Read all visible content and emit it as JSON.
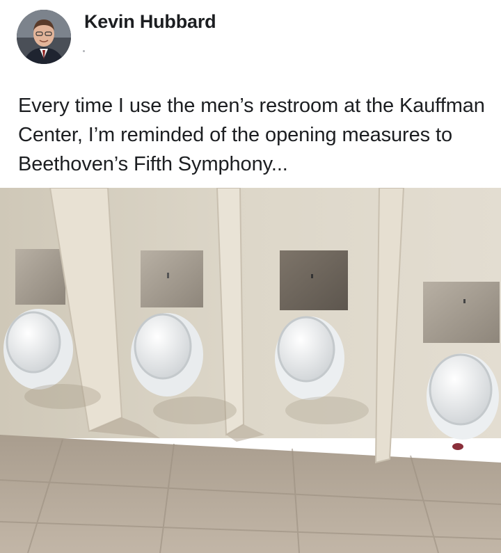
{
  "post": {
    "author_name": "Kevin Hubbard",
    "avatar_icon": "person-avatar-icon",
    "text": "Every time I use the men’s restroom at the Kauffman Center, I’m reminded of the opening measures to Beethoven’s Fifth Symphony...",
    "photo": {
      "subject": "urinals-photo",
      "colors": {
        "wall": "#d9d3c4",
        "floor": "#b7aa9a",
        "partition": "#e6dfd1",
        "porcelain": "#f4f6f7",
        "plate": "#a49b8f"
      }
    }
  }
}
